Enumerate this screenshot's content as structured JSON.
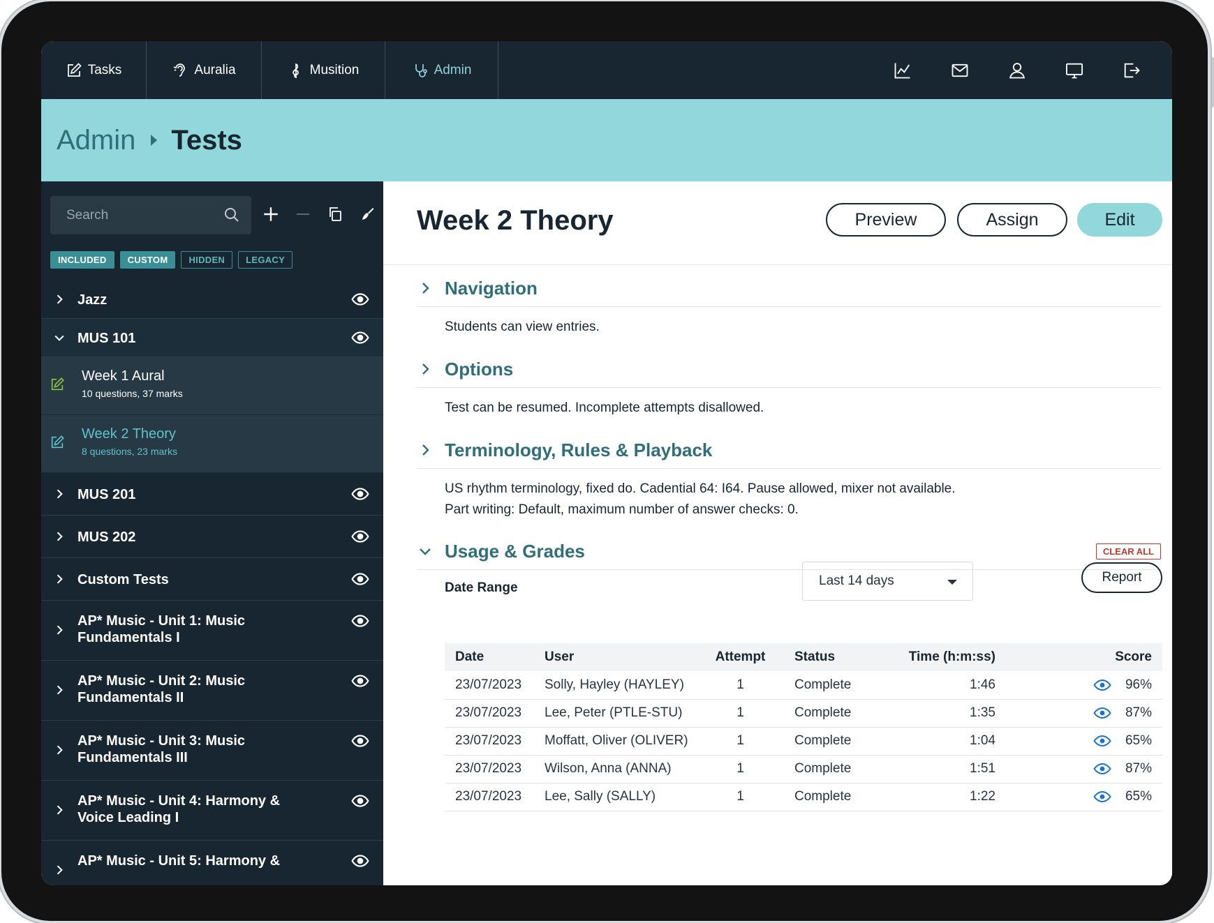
{
  "nav": {
    "tabs": [
      {
        "label": "Tasks",
        "icon": "edit-icon"
      },
      {
        "label": "Auralia",
        "icon": "ear-icon"
      },
      {
        "label": "Musition",
        "icon": "treble-clef-icon"
      },
      {
        "label": "Admin",
        "icon": "stethoscope-icon",
        "active": true
      }
    ],
    "right_icons": [
      "chart-icon",
      "mail-icon",
      "user-icon",
      "monitor-icon",
      "logout-icon"
    ]
  },
  "breadcrumb": {
    "parent": "Admin",
    "current": "Tests"
  },
  "sidebar": {
    "search_placeholder": "Search",
    "filters": [
      {
        "label": "INCLUDED",
        "active": true
      },
      {
        "label": "CUSTOM",
        "active": true
      },
      {
        "label": "HIDDEN",
        "active": false
      },
      {
        "label": "LEGACY",
        "active": false
      }
    ],
    "folders": [
      {
        "label": "Jazz",
        "expanded": false
      },
      {
        "label": "MUS 101",
        "expanded": true,
        "children": [
          {
            "title": "Week 1 Aural",
            "subtitle": "10 questions, 37 marks",
            "selected": false
          },
          {
            "title": "Week 2 Theory",
            "subtitle": "8 questions, 23 marks",
            "selected": true
          }
        ]
      },
      {
        "label": "MUS 201",
        "expanded": false
      },
      {
        "label": "MUS 202",
        "expanded": false
      },
      {
        "label": "Custom Tests",
        "expanded": false
      },
      {
        "label": "AP* Music - Unit 1: Music Fundamentals I",
        "expanded": false
      },
      {
        "label": "AP* Music - Unit 2: Music Fundamentals II",
        "expanded": false
      },
      {
        "label": "AP* Music - Unit 3: Music Fundamentals III",
        "expanded": false
      },
      {
        "label": "AP* Music - Unit 4: Harmony & Voice Leading I",
        "expanded": false
      },
      {
        "label": "AP* Music - Unit 5: Harmony &",
        "expanded": false
      }
    ]
  },
  "main": {
    "title": "Week 2 Theory",
    "buttons": {
      "preview": "Preview",
      "assign": "Assign",
      "edit": "Edit"
    },
    "sections": {
      "navigation": {
        "title": "Navigation",
        "body": "Students can view entries."
      },
      "options": {
        "title": "Options",
        "body": "Test can be resumed. Incomplete attempts disallowed."
      },
      "terminology": {
        "title": "Terminology, Rules & Playback",
        "line1": "US rhythm terminology, fixed do. Cadential 64: I64. Pause allowed, mixer not available.",
        "line2": "Part writing: Default, maximum number of answer checks: 0."
      },
      "usage": {
        "title": "Usage & Grades",
        "clear_all": "CLEAR ALL"
      }
    },
    "date_range": {
      "label": "Date Range",
      "selected": "Last 14 days"
    },
    "report_button": "Report",
    "table": {
      "headers": [
        "Date",
        "User",
        "Attempt",
        "Status",
        "Time (h:m:ss)",
        "Score"
      ],
      "rows": [
        [
          "23/07/2023",
          "Solly, Hayley (HAYLEY)",
          "1",
          "Complete",
          "1:46",
          "96%"
        ],
        [
          "23/07/2023",
          "Lee, Peter (PTLE-STU)",
          "1",
          "Complete",
          "1:35",
          "87%"
        ],
        [
          "23/07/2023",
          "Moffatt, Oliver (OLIVER)",
          "1",
          "Complete",
          "1:04",
          "65%"
        ],
        [
          "23/07/2023",
          "Wilson, Anna (ANNA)",
          "1",
          "Complete",
          "1:51",
          "87%"
        ],
        [
          "23/07/2023",
          "Lee, Sally (SALLY)",
          "1",
          "Complete",
          "1:22",
          "65%"
        ]
      ]
    }
  },
  "colors": {
    "nav_bg": "#172631",
    "banner_bg": "#92d7db",
    "accent": "#2f6e7a",
    "selected_text": "#5fc3cb",
    "eye_blue": "#1a73c8",
    "clear_red": "#c0392b"
  }
}
